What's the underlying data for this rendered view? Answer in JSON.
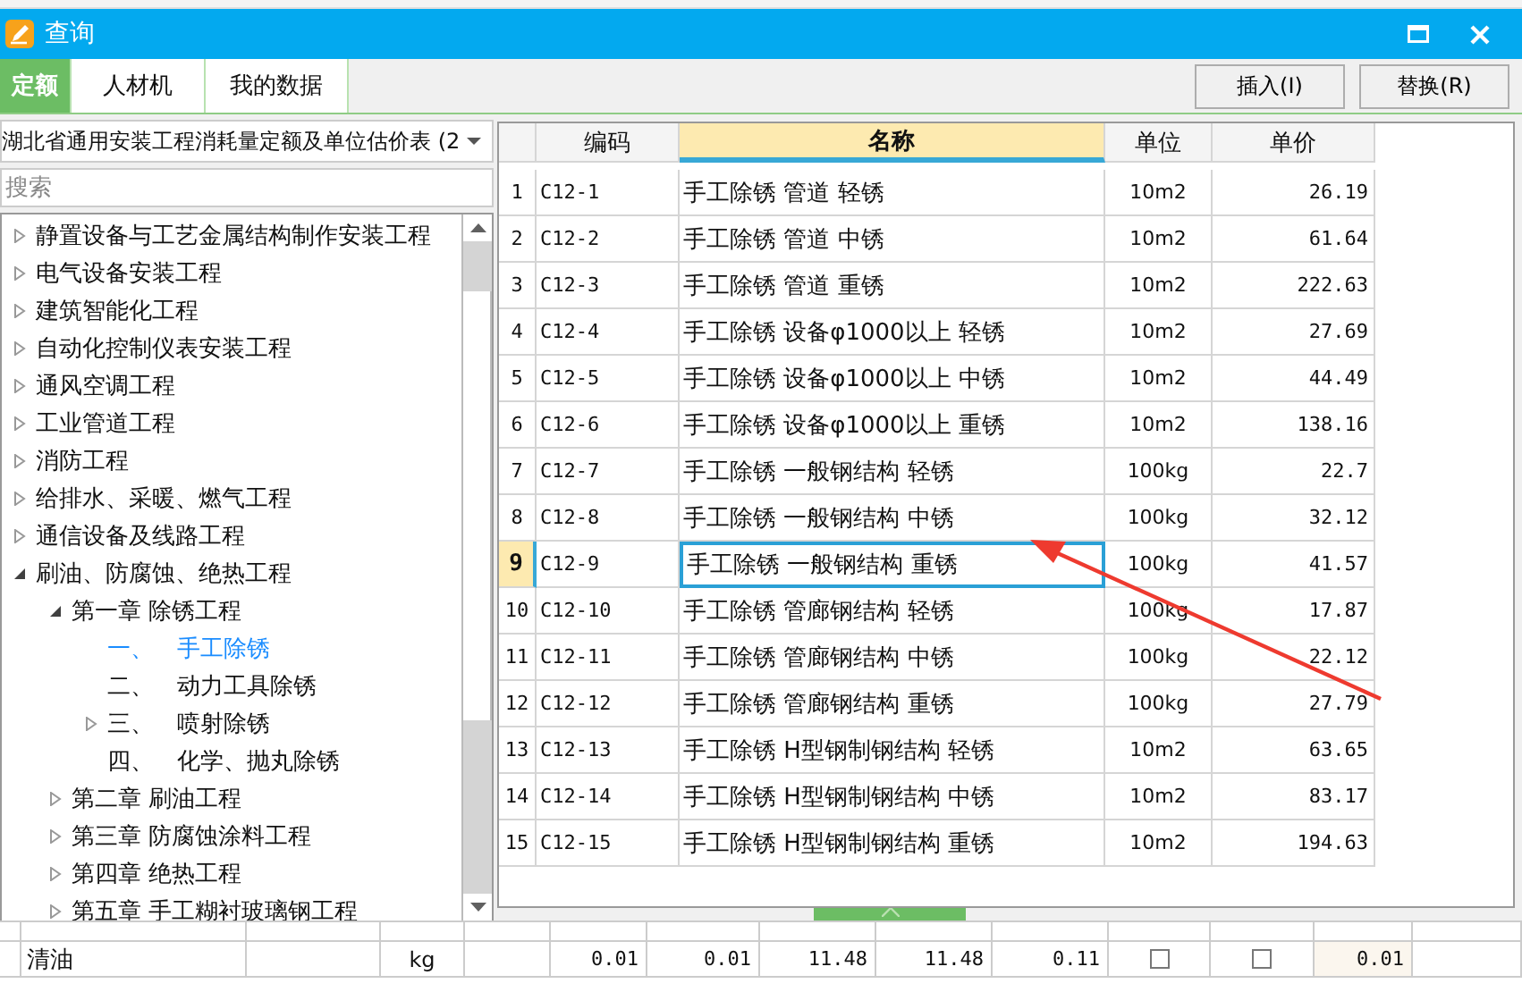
{
  "window": {
    "title": "查询"
  },
  "tabs": [
    {
      "label": "定额",
      "selected": true
    },
    {
      "label": "人材机",
      "selected": false
    },
    {
      "label": "我的数据",
      "selected": false
    }
  ],
  "buttons": [
    "插入(I)",
    "替换(R)"
  ],
  "library": {
    "value": "湖北省通用安装工程消耗量定额及单位估价表 (2"
  },
  "search": {
    "placeholder": "搜索"
  },
  "tree": [
    {
      "label": "静置设备与工艺金属结构制作安装工程",
      "expanded": false,
      "selected": false
    },
    {
      "label": "电气设备安装工程",
      "expanded": false,
      "selected": false
    },
    {
      "label": "建筑智能化工程",
      "expanded": false,
      "selected": false
    },
    {
      "label": "自动化控制仪表安装工程",
      "expanded": false,
      "selected": false
    },
    {
      "label": "通风空调工程",
      "expanded": false,
      "selected": false
    },
    {
      "label": "工业管道工程",
      "expanded": false,
      "selected": false
    },
    {
      "label": "消防工程",
      "expanded": false,
      "selected": false
    },
    {
      "label": "给排水、采暖、燃气工程",
      "expanded": false,
      "selected": false
    },
    {
      "label": "通信设备及线路工程",
      "expanded": false,
      "selected": false
    },
    {
      "label": "刷油、防腐蚀、绝热工程",
      "expanded": true,
      "selected": false,
      "children": [
        {
          "label": "第一章 除锈工程",
          "expanded": true,
          "selected": false,
          "children": [
            {
              "label": "一、　手工除锈",
              "selected": true
            },
            {
              "label": "二、　动力工具除锈",
              "selected": false
            },
            {
              "label": "三、　喷射除锈",
              "expanded": false,
              "selected": false
            },
            {
              "label": "四、　化学、抛丸除锈",
              "selected": false
            }
          ]
        },
        {
          "label": "第二章 刷油工程",
          "expanded": false,
          "selected": false
        },
        {
          "label": "第三章 防腐蚀涂料工程",
          "expanded": false,
          "selected": false
        },
        {
          "label": "第四章 绝热工程",
          "expanded": false,
          "selected": false
        },
        {
          "label": "第五章 手工糊衬玻璃钢工程",
          "expanded": false,
          "selected": false
        }
      ]
    }
  ],
  "table": {
    "columns": [
      {
        "label": "编码",
        "selected": false
      },
      {
        "label": "名称",
        "selected": true
      },
      {
        "label": "单位",
        "selected": false
      },
      {
        "label": "单价",
        "selected": false
      }
    ],
    "rows": [
      {
        "no": "1",
        "code": "C12-1",
        "name": "手工除锈 管道 轻锈",
        "unit": "10m2",
        "price": "26.19",
        "selected": false
      },
      {
        "no": "2",
        "code": "C12-2",
        "name": "手工除锈 管道 中锈",
        "unit": "10m2",
        "price": "61.64",
        "selected": false
      },
      {
        "no": "3",
        "code": "C12-3",
        "name": "手工除锈 管道 重锈",
        "unit": "10m2",
        "price": "222.63",
        "selected": false
      },
      {
        "no": "4",
        "code": "C12-4",
        "name": "手工除锈 设备φ1000以上 轻锈",
        "unit": "10m2",
        "price": "27.69",
        "selected": false
      },
      {
        "no": "5",
        "code": "C12-5",
        "name": "手工除锈 设备φ1000以上 中锈",
        "unit": "10m2",
        "price": "44.49",
        "selected": false
      },
      {
        "no": "6",
        "code": "C12-6",
        "name": "手工除锈 设备φ1000以上 重锈",
        "unit": "10m2",
        "price": "138.16",
        "selected": false
      },
      {
        "no": "7",
        "code": "C12-7",
        "name": "手工除锈 一般钢结构 轻锈",
        "unit": "100kg",
        "price": "22.7",
        "selected": false
      },
      {
        "no": "8",
        "code": "C12-8",
        "name": "手工除锈 一般钢结构 中锈",
        "unit": "100kg",
        "price": "32.12",
        "selected": false
      },
      {
        "no": "9",
        "code": "C12-9",
        "name": "手工除锈 一般钢结构 重锈",
        "unit": "100kg",
        "price": "41.57",
        "selected": true
      },
      {
        "no": "10",
        "code": "C12-10",
        "name": "手工除锈 管廊钢结构 轻锈",
        "unit": "100kg",
        "price": "17.87",
        "selected": false
      },
      {
        "no": "11",
        "code": "C12-11",
        "name": "手工除锈 管廊钢结构 中锈",
        "unit": "100kg",
        "price": "22.12",
        "selected": false
      },
      {
        "no": "12",
        "code": "C12-12",
        "name": "手工除锈 管廊钢结构 重锈",
        "unit": "100kg",
        "price": "27.79",
        "selected": false
      },
      {
        "no": "13",
        "code": "C12-13",
        "name": "手工除锈 H型钢制钢结构 轻锈",
        "unit": "10m2",
        "price": "63.65",
        "selected": false
      },
      {
        "no": "14",
        "code": "C12-14",
        "name": "手工除锈 H型钢制钢结构 中锈",
        "unit": "10m2",
        "price": "83.17",
        "selected": false
      },
      {
        "no": "15",
        "code": "C12-15",
        "name": "手工除锈 H型钢制钢结构 重锈",
        "unit": "10m2",
        "price": "194.63",
        "selected": false
      }
    ]
  },
  "background_table": {
    "rows": [
      {
        "name": "清油",
        "unit": "kg",
        "values": [
          "0.01",
          "0.01",
          "11.48",
          "11.48",
          "0.11"
        ],
        "checks": [
          false,
          false
        ],
        "total": "0.01"
      }
    ]
  }
}
